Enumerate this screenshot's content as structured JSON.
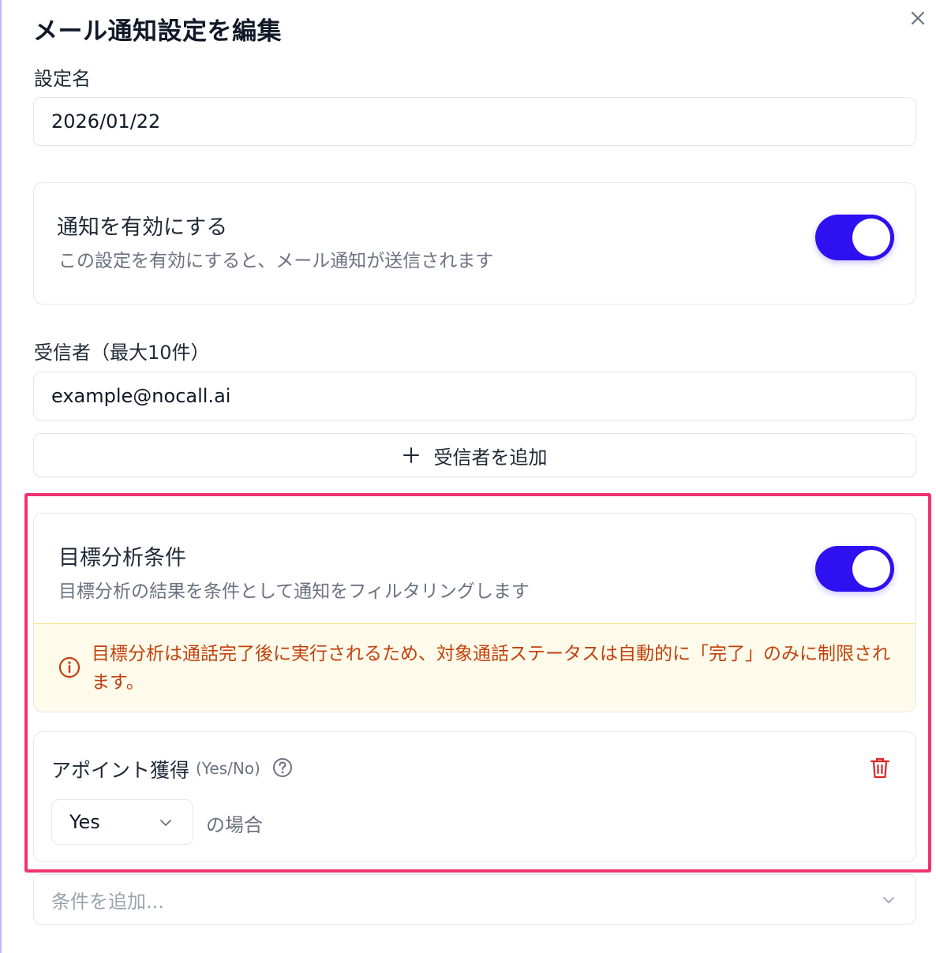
{
  "dialog": {
    "title": "メール通知設定を編集",
    "close_icon": "close-icon"
  },
  "setting_name": {
    "label": "設定名",
    "value": "2026/01/22"
  },
  "enable_notification": {
    "title": "通知を有効にする",
    "description": "この設定を有効にすると、メール通知が送信されます",
    "enabled": true
  },
  "recipients": {
    "label": "受信者（最大10件）",
    "items": [
      "example@nocall.ai"
    ],
    "add_button_label": "受信者を追加",
    "add_icon": "plus-icon"
  },
  "goal_analysis": {
    "title": "目標分析条件",
    "description": "目標分析の結果を条件として通知をフィルタリングします",
    "enabled": true,
    "warning": "目標分析は通話完了後に実行されるため、対象通話ステータスは自動的に「完了」のみに制限されます。",
    "warning_icon": "info-icon",
    "condition": {
      "name": "アポイント獲得",
      "type_hint": "(Yes/No)",
      "help_icon": "help-icon",
      "delete_icon": "trash-icon",
      "selected_value": "Yes",
      "suffix": "の場合"
    },
    "add_condition_placeholder": "条件を追加..."
  },
  "colors": {
    "toggle_on": "#2e10f0",
    "highlight_border": "#f0336f",
    "warning_bg": "#fffbeb",
    "warning_text": "#c2410c",
    "delete_icon": "#dc2626"
  }
}
